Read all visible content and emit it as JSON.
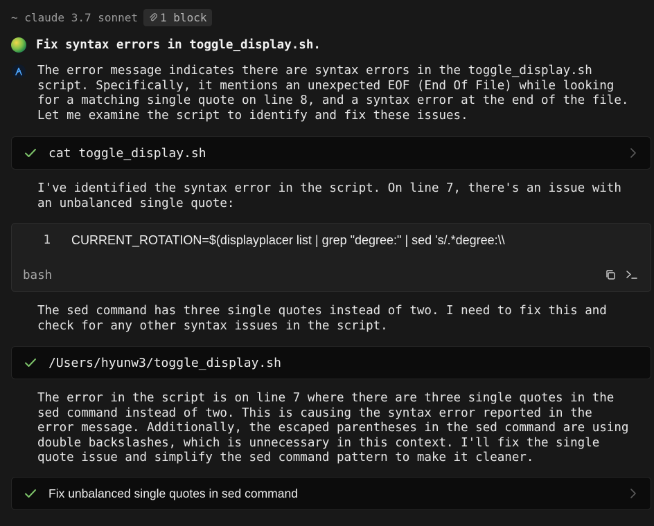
{
  "header": {
    "model": "~ claude 3.7 sonnet",
    "block_badge": "1 block"
  },
  "task": {
    "title": "Fix syntax errors in toggle_display.sh."
  },
  "messages": {
    "m1": "The error message indicates there are syntax errors in the toggle_display.sh\nscript. Specifically, it mentions an unexpected EOF (End Of File) while looking\nfor a matching single quote on line 8, and a syntax error at the end of the file.\nLet me examine the script to identify and fix these issues.",
    "m2": "I've identified the syntax error in the script. On line 7, there's an issue with\nan unbalanced single quote:",
    "m3": "The sed command has three single quotes instead of two. I need to fix this and\ncheck for any other syntax issues in the script.",
    "m4": "The error in the script is on line 7 where there are three single quotes in the\nsed command instead of two. This is causing the syntax error reported in the\nerror message. Additionally, the escaped parentheses in the sed command are using\ndouble backslashes, which is unnecessary in this context. I'll fix the single\nquote issue and simplify the sed command pattern to make it cleaner."
  },
  "tools": {
    "t1": "cat toggle_display.sh",
    "t2": "/Users/hyunw3/toggle_display.sh",
    "t3": "Fix unbalanced single quotes in sed command"
  },
  "code": {
    "line_number": "1",
    "text": "CURRENT_ROTATION=$(displayplacer list | grep \"degree:\" | sed 's/.*degree:\\\\",
    "language": "bash"
  },
  "icons": {
    "attachment": "paperclip-icon",
    "check": "check-icon",
    "chevron": "chevron-right-icon",
    "copy": "copy-icon",
    "terminal": "terminal-icon"
  },
  "colors": {
    "background": "#181818",
    "check_green": "#7ec46a",
    "avatar_blue": "#4ea7ff"
  }
}
